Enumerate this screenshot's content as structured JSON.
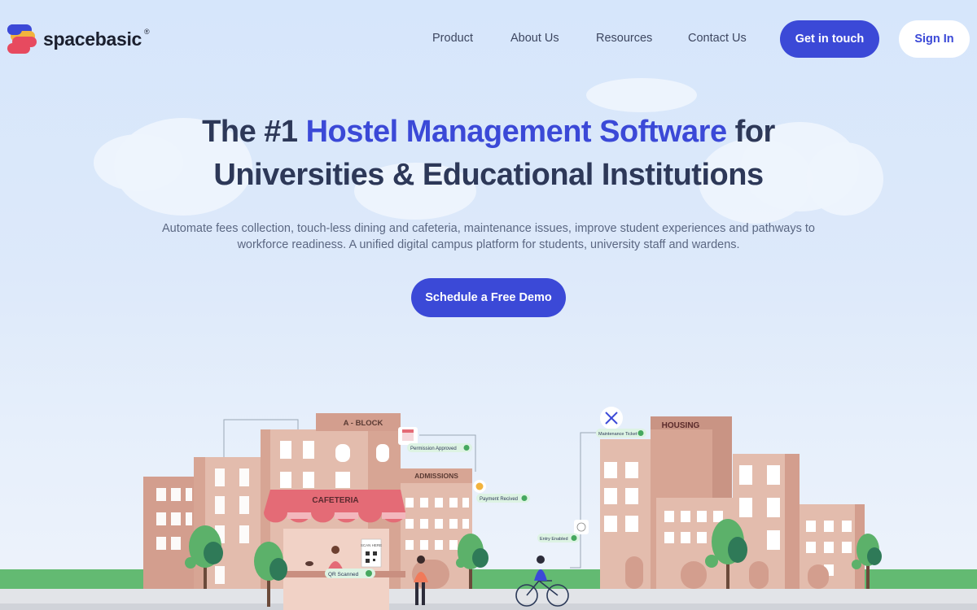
{
  "brand": {
    "name": "spacebasic",
    "reg": "®"
  },
  "nav": {
    "items": [
      "Product",
      "About Us",
      "Resources",
      "Contact Us"
    ]
  },
  "header": {
    "get_in_touch": "Get in touch",
    "sign_in": "Sign In"
  },
  "hero": {
    "title_part1": "The #1 ",
    "title_accent": "Hostel Management Software",
    "title_part2": " for",
    "title_line2": "Universities & Educational Institutions",
    "subtitle": "Automate fees collection, touch-less dining and cafeteria, maintenance issues, improve student experiences and pathways to workforce readiness. A unified digital campus platform for students, university staff and wardens.",
    "cta": "Schedule a Free Demo"
  },
  "illustration": {
    "building_a_block": "A - BLOCK",
    "building_admissions": "ADMISSIONS",
    "building_cafeteria": "CAFETERIA",
    "building_housing": "HOUSING",
    "scan_here": "SCAN HERE",
    "tag_permission": "Permission Approved",
    "tag_payment": "Payment Recived",
    "tag_maintenance": "Maintenance Ticket",
    "tag_entry": "Entry Enabled",
    "tag_qr": "QR Scanned"
  },
  "colors": {
    "primary": "#3b49d7",
    "heading": "#2d3858",
    "building": "#e0b7a7",
    "awning": "#e46b76",
    "grass": "#5fb86e"
  }
}
